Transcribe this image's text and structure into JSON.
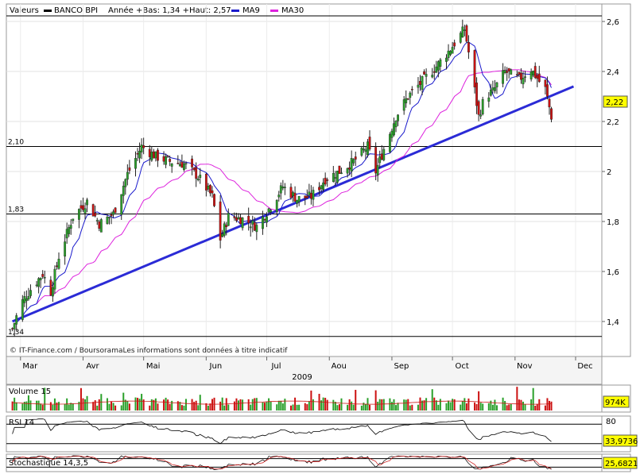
{
  "header": {
    "label": "Valeurs",
    "legend": [
      {
        "name": "BANCO BPI",
        "color": "#000000"
      },
      {
        "name": "Année +Bas: 1,34 +Haut: 2,57",
        "color": null
      },
      {
        "name": "MA9",
        "color": "#1a1acc"
      },
      {
        "name": "MA30",
        "color": "#dd22dd"
      }
    ]
  },
  "colors": {
    "up": "#2aa02a",
    "down": "#cc1111",
    "ma9": "#1a1acc",
    "ma30": "#dd22dd",
    "trend": "#2b2bd6",
    "volume_ma": "#cc1111",
    "rsi": "#000000",
    "stoch_k": "#000000",
    "stoch_d": "#cc1111"
  },
  "chart_data": [
    {
      "type": "candlestick",
      "title": "BANCO BPI",
      "x_year": "2009",
      "x_ticks": [
        "Mar",
        "Avr",
        "Mai",
        "Jun",
        "Jul",
        "Aou",
        "Sep",
        "Oct",
        "Nov",
        "Dec"
      ],
      "y_ticks": [
        "1,4",
        "1,6",
        "1,8",
        "2",
        "2,2",
        "2,4",
        "2,6"
      ],
      "ylim": [
        1.26,
        2.67
      ],
      "last_value_label": "2,22",
      "reference_lines": [
        {
          "label": "2,10",
          "value": 2.1
        },
        {
          "label": "1,83",
          "value": 1.83
        },
        {
          "label": "1,34",
          "value": 1.34
        }
      ],
      "trendline": {
        "from": [
          "2009-02-25",
          1.4
        ],
        "to": [
          "2009-11-30",
          2.34
        ]
      },
      "close_anchors": [
        [
          "2009-02-25",
          1.37
        ],
        [
          "2009-03-01",
          1.47
        ],
        [
          "2009-03-07",
          1.54
        ],
        [
          "2009-03-12",
          1.59
        ],
        [
          "2009-03-16",
          1.52
        ],
        [
          "2009-03-20",
          1.66
        ],
        [
          "2009-03-27",
          1.82
        ],
        [
          "2009-04-03",
          1.88
        ],
        [
          "2009-04-09",
          1.79
        ],
        [
          "2009-04-16",
          1.83
        ],
        [
          "2009-04-23",
          1.99
        ],
        [
          "2009-04-30",
          2.1
        ],
        [
          "2009-05-07",
          2.06
        ],
        [
          "2009-05-14",
          2.04
        ],
        [
          "2009-05-21",
          2.03
        ],
        [
          "2009-05-28",
          1.98
        ],
        [
          "2009-06-04",
          1.9
        ],
        [
          "2009-06-08",
          1.73
        ],
        [
          "2009-06-12",
          1.82
        ],
        [
          "2009-06-19",
          1.81
        ],
        [
          "2009-06-26",
          1.78
        ],
        [
          "2009-07-02",
          1.85
        ],
        [
          "2009-07-09",
          1.94
        ],
        [
          "2009-07-16",
          1.89
        ],
        [
          "2009-07-23",
          1.9
        ],
        [
          "2009-07-30",
          1.97
        ],
        [
          "2009-08-06",
          2.0
        ],
        [
          "2009-08-13",
          2.04
        ],
        [
          "2009-08-20",
          2.1
        ],
        [
          "2009-08-24",
          2.0
        ],
        [
          "2009-08-28",
          2.09
        ],
        [
          "2009-09-03",
          2.22
        ],
        [
          "2009-09-09",
          2.3
        ],
        [
          "2009-09-16",
          2.36
        ],
        [
          "2009-09-23",
          2.42
        ],
        [
          "2009-09-30",
          2.49
        ],
        [
          "2009-10-07",
          2.57
        ],
        [
          "2009-10-10",
          2.43
        ],
        [
          "2009-10-14",
          2.22
        ],
        [
          "2009-10-17",
          2.3
        ],
        [
          "2009-10-21",
          2.32
        ],
        [
          "2009-10-27",
          2.4
        ],
        [
          "2009-11-03",
          2.37
        ],
        [
          "2009-11-09",
          2.41
        ],
        [
          "2009-11-13",
          2.36
        ],
        [
          "2009-11-16",
          2.33
        ],
        [
          "2009-11-19",
          2.22
        ]
      ]
    },
    {
      "type": "bar",
      "title": "Volume 15",
      "last_value_label": "974K",
      "y_ticks": []
    },
    {
      "type": "line",
      "title": "RSI 14",
      "ylim": [
        0,
        100
      ],
      "y_ticks": [
        "80"
      ],
      "last_value_label": "33,9736"
    },
    {
      "type": "line",
      "title": "Stochastique 14,3,5",
      "ylim": [
        0,
        100
      ],
      "last_value_label": "25,6821"
    }
  ],
  "source": "© IT-Finance.com / BoursoramaLes informations sont données à titre indicatif"
}
